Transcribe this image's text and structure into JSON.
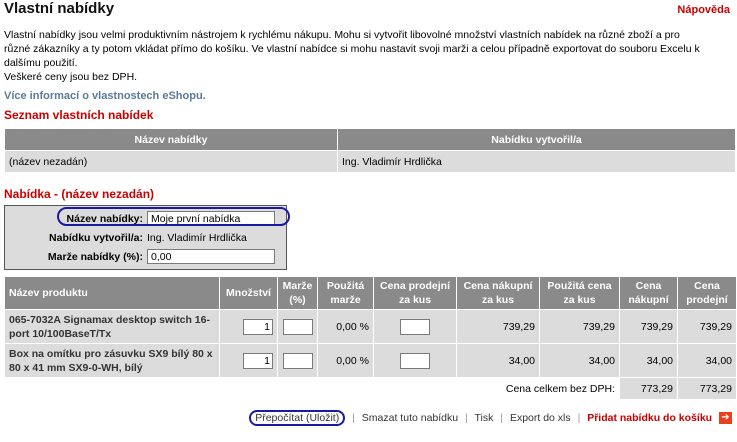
{
  "header": {
    "title": "Vlastní nabídky",
    "help_label": "Nápověda"
  },
  "intro": {
    "text": "Vlastní nabídky jsou velmi produktivním nástrojem k rychlému nákupu. Mohu si vytvořit libovolné množství vlastních nabídek na různé zboží a pro různé zákazníky a ty potom vkládat přímo do košíku. Ve vlastní nabídce si mohu nastavit svoji marži a celou případně exportovat do souboru Excelu k dalšímu použití.",
    "vat_note": "Veškeré ceny jsou bez DPH.",
    "more_link": "Více informací o vlastnostech eShopu."
  },
  "offer_list": {
    "section_title": "Seznam vlastních nabídek",
    "headers": [
      "Název nabídky",
      "Nabídku vytvořil/a"
    ],
    "rows": [
      {
        "name": "(název nezadán)",
        "author": "Ing. Vladimír Hrdlička"
      }
    ]
  },
  "offer_detail": {
    "section_title": "Nabídka - (název nezadán)",
    "name_label": "Název nabídky:",
    "name_value": "Moje první nabídka",
    "author_label": "Nabídku vytvořil/a:",
    "author_value": "Ing. Vladimír Hrdlička",
    "margin_label": "Marže nabídky (%):",
    "margin_value": "0,00"
  },
  "products": {
    "headers": [
      "Název produktu",
      "Množství",
      "Marže (%)",
      "Použitá marže",
      "Cena prodejní za kus",
      "Cena nákupní za kus",
      "Použitá cena za kus",
      "Cena nákupní",
      "Cena prodejní"
    ],
    "rows": [
      {
        "name": "065-7032A Signamax desktop switch 16-port 10/100BaseT/Tx",
        "qty": "1",
        "margin": "",
        "used_margin": "0,00 %",
        "sell_unit": "",
        "buy_unit": "739,29",
        "used_unit": "739,29",
        "buy_total": "739,29",
        "sell_total": "739,29"
      },
      {
        "name": "Box na omítku pro zásuvku SX9 bílý 80 x 80 x 41 mm SX9-0-WH, bílý",
        "qty": "1",
        "margin": "",
        "used_margin": "0,00 %",
        "sell_unit": "",
        "buy_unit": "34,00",
        "used_unit": "34,00",
        "buy_total": "34,00",
        "sell_total": "34,00"
      }
    ],
    "total_label": "Cena celkem bez DPH:",
    "total_buy": "773,29",
    "total_sell": "773,29"
  },
  "actions": {
    "recalc": "Přepočítat (Uložit)",
    "delete": "Smazat tuto nabídku",
    "print": "Tisk",
    "export": "Export do xls",
    "add_to_cart": "Přidat nabídku do košíku",
    "separator": "|"
  }
}
